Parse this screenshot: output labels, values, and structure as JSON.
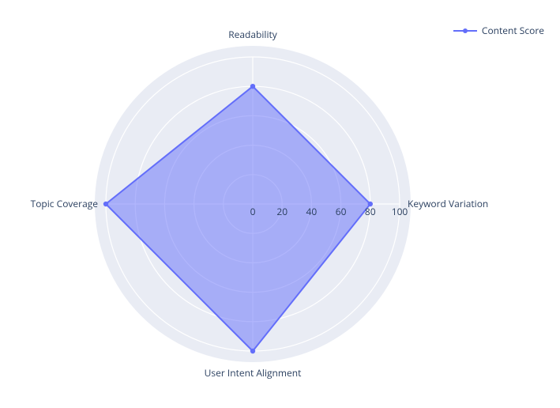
{
  "legend": {
    "label": "Content Score"
  },
  "ticks": [
    "0",
    "20",
    "40",
    "60",
    "80",
    "100"
  ],
  "axes": {
    "right": "Keyword Variation",
    "top": "Readability",
    "left": "Topic Coverage",
    "bottom": "User Intent Alignment"
  },
  "chart_data": {
    "type": "radar",
    "axis_range": [
      0,
      100
    ],
    "ticks": [
      0,
      20,
      40,
      60,
      80,
      100
    ],
    "categories": [
      "Readability",
      "Keyword Variation",
      "User Intent Alignment",
      "Topic Coverage"
    ],
    "series": [
      {
        "name": "Content Score",
        "values": [
          80,
          80,
          100,
          100
        ]
      }
    ],
    "grid_on": true,
    "legend_position": "top-right",
    "fill_color": "#636efa",
    "fill_opacity": 0.5
  }
}
